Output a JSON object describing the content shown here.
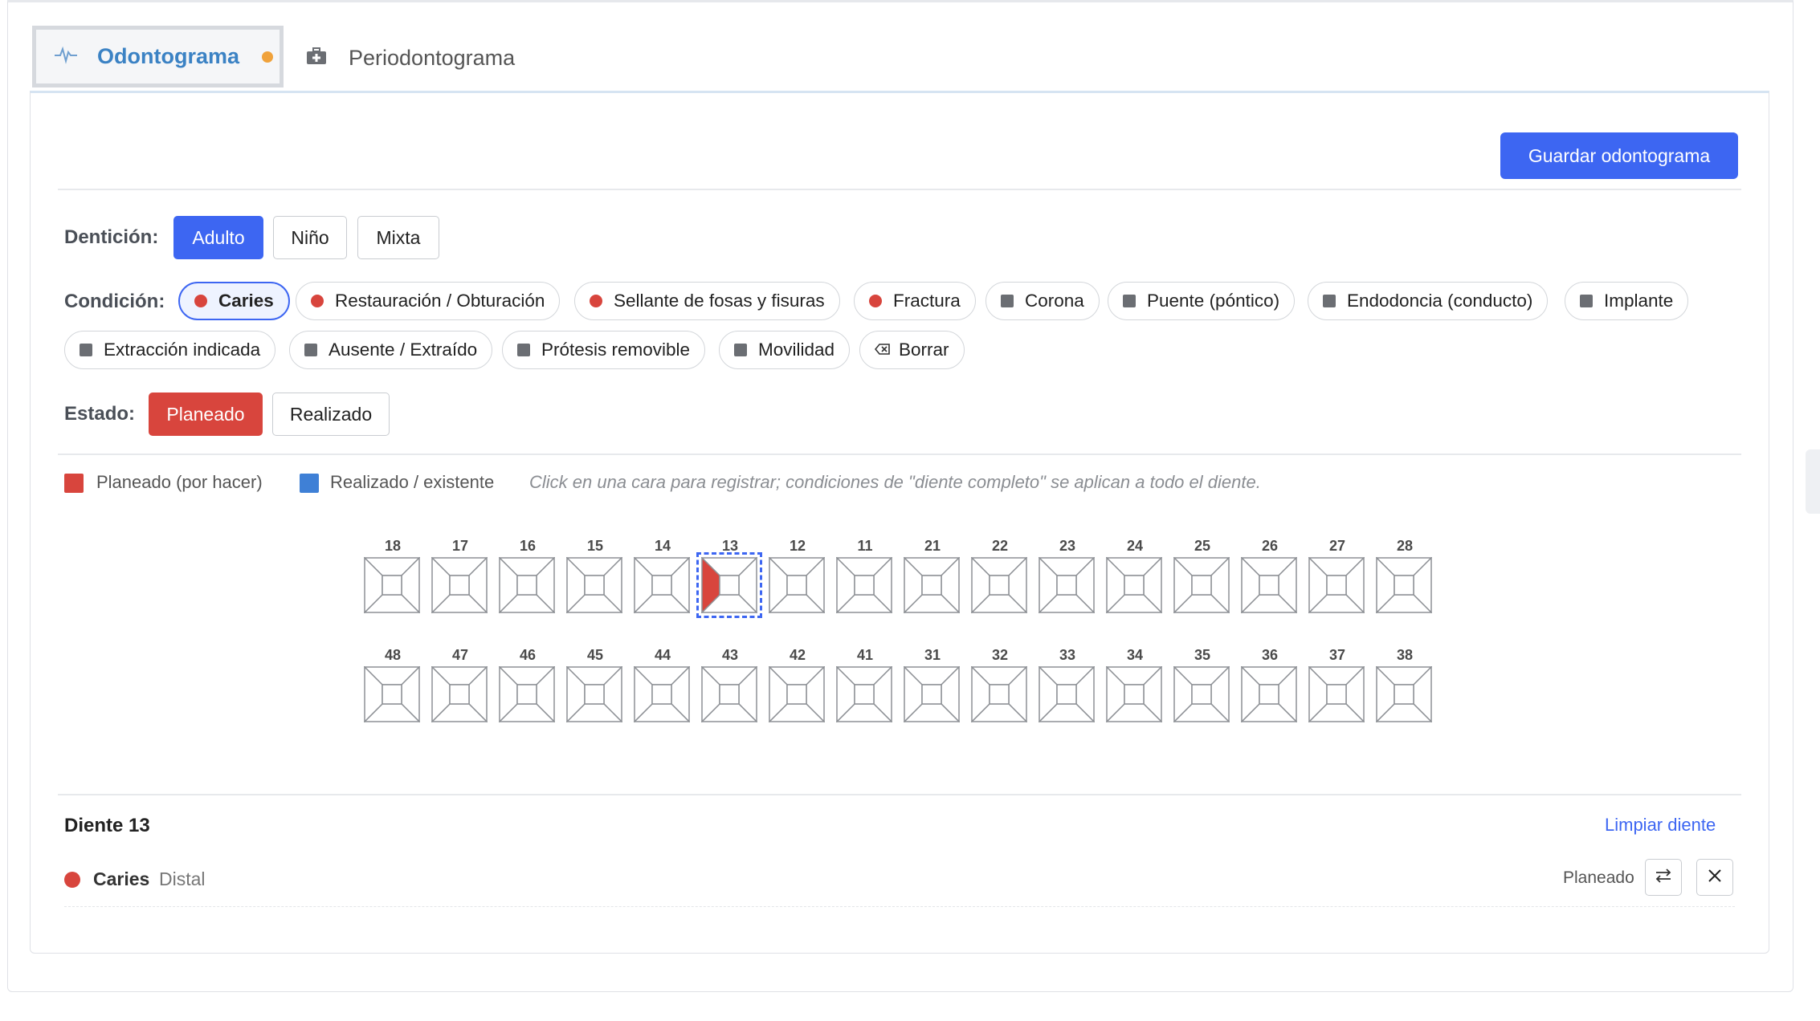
{
  "tabs": [
    {
      "label": "Odontograma",
      "icon": "pulse-icon",
      "active": true,
      "unsaved_dot_color": "#f0a23b"
    },
    {
      "label": "Periodontograma",
      "icon": "medical-kit-icon",
      "active": false
    }
  ],
  "toolbar": {
    "save_label": "Guardar odontograma"
  },
  "denticion": {
    "label": "Dentición:",
    "options": [
      "Adulto",
      "Niño",
      "Mixta"
    ],
    "selected": "Adulto"
  },
  "condicion": {
    "label": "Condición:",
    "options": [
      {
        "label": "Caries",
        "marker": "dot",
        "color": "#d8453d",
        "selected": true
      },
      {
        "label": "Restauración / Obturación",
        "marker": "dot",
        "color": "#d8453d"
      },
      {
        "label": "Sellante de fosas y fisuras",
        "marker": "dot",
        "color": "#d8453d"
      },
      {
        "label": "Fractura",
        "marker": "dot",
        "color": "#d8453d"
      },
      {
        "label": "Corona",
        "marker": "square",
        "color": "#6b6e73"
      },
      {
        "label": "Puente (póntico)",
        "marker": "square",
        "color": "#6b6e73"
      },
      {
        "label": "Endodoncia (conducto)",
        "marker": "square",
        "color": "#6b6e73"
      },
      {
        "label": "Implante",
        "marker": "square",
        "color": "#6b6e73"
      },
      {
        "label": "Extracción indicada",
        "marker": "square",
        "color": "#6b6e73"
      },
      {
        "label": "Ausente / Extraído",
        "marker": "square",
        "color": "#6b6e73"
      },
      {
        "label": "Prótesis removible",
        "marker": "square",
        "color": "#6b6e73"
      },
      {
        "label": "Movilidad",
        "marker": "square",
        "color": "#6b6e73"
      },
      {
        "label": "Borrar",
        "marker": "eraser-icon"
      }
    ]
  },
  "estado": {
    "label": "Estado:",
    "options": [
      "Planeado",
      "Realizado"
    ],
    "selected": "Planeado"
  },
  "legend": {
    "planned": {
      "label": "Planeado (por hacer)",
      "color": "#d8453d"
    },
    "done": {
      "label": "Realizado / existente",
      "color": "#3f80d6"
    },
    "hint": "Click en una cara para registrar; condiciones de \"diente completo\" se aplican a todo el diente."
  },
  "teeth": {
    "upper": [
      "18",
      "17",
      "16",
      "15",
      "14",
      "13",
      "12",
      "11",
      "21",
      "22",
      "23",
      "24",
      "25",
      "26",
      "27",
      "28"
    ],
    "lower": [
      "48",
      "47",
      "46",
      "45",
      "44",
      "43",
      "42",
      "41",
      "31",
      "32",
      "33",
      "34",
      "35",
      "36",
      "37",
      "38"
    ],
    "selected": "13",
    "marks": [
      {
        "tooth": "13",
        "face": "left",
        "color": "#d8453d"
      }
    ]
  },
  "detail": {
    "title": "Diente 13",
    "clear_label": "Limpiar diente",
    "conditions": [
      {
        "name": "Caries",
        "face": "Distal",
        "status": "Planeado",
        "color": "#d8453d"
      }
    ]
  }
}
